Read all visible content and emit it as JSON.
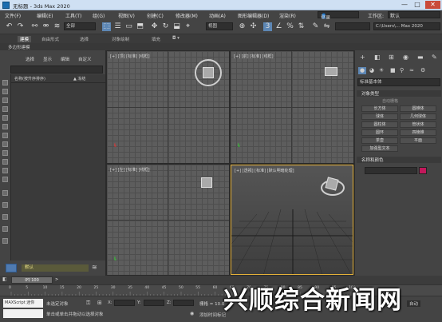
{
  "window": {
    "title": "无标题 - 3ds Max 2020",
    "min": "—",
    "max": "□",
    "close": "✕"
  },
  "menu": {
    "left": [
      "文件(F)",
      "编辑(E)",
      "工具(T)",
      "组(G)",
      "视图(V)",
      "创建(C)",
      "修改器(M)",
      "动画(A)",
      "图形编辑器(D)",
      "渲染(R)"
    ],
    "user": "登录",
    "workspace_label": "工作区:",
    "workspace_value": "默认"
  },
  "toolbar": {
    "selection_filter": "全部",
    "ref_coord": "视图",
    "project_path": "C:\\Users\\... Max 2020"
  },
  "ribbon": {
    "tabs": [
      "建模",
      "自由形式",
      "选择",
      "对象绘制",
      "填充"
    ],
    "sub": "多边形建模"
  },
  "scene_explorer": {
    "tabs": [
      "选择",
      "显示",
      "编辑",
      "自定义"
    ],
    "columns": [
      "名称(按升序排序)",
      "▲ 冻结"
    ],
    "layer": "默认"
  },
  "viewports": {
    "top": "[+] [顶] [标准] [线框]",
    "front": "[+] [前] [标准] [线框]",
    "left": "[+] [左] [标准] [线框]",
    "persp": "[+] [透视] [标准] [默认明暗处理]"
  },
  "command_panel": {
    "category": "标准基本体",
    "rollout_object": "对象类型",
    "autogrid": "自动栅格",
    "buttons": [
      "长方体",
      "圆锥体",
      "球体",
      "几何球体",
      "圆柱体",
      "管状体",
      "圆环",
      "四棱锥",
      "茶壶",
      "平面",
      "加强型文本"
    ],
    "rollout_name": "名称和颜色",
    "accent_color": "#c2185b"
  },
  "timeline": {
    "frame": "0 / 100"
  },
  "ruler": {
    "ticks": [
      "0",
      "5",
      "10",
      "15",
      "20",
      "25",
      "30",
      "35",
      "40",
      "45",
      "50",
      "55",
      "60",
      "65",
      "70",
      "75",
      "80",
      "85",
      "90",
      "95",
      "100"
    ]
  },
  "status": {
    "maxscript": "MAXScript 迷你",
    "selection": "未选定对象",
    "hint": "单击或单击并拖动以选择对象",
    "x": "X:",
    "y": "Y:",
    "z": "Z:",
    "grid": "栅格 = 10.0",
    "add_time_tag": "添加时间标记",
    "auto_key": "自动"
  },
  "watermark": "兴顺综合新闻网"
}
